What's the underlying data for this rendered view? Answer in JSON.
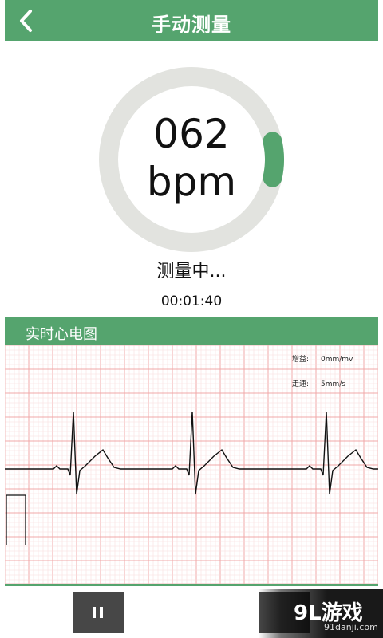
{
  "header": {
    "title": "手动测量",
    "back_icon": "chevron-left-icon"
  },
  "gauge": {
    "value": "062",
    "unit": "bpm",
    "progress_fraction": 0.07,
    "track_color": "#e2e3df",
    "fill_color": "#55a46e"
  },
  "measurement": {
    "status": "测量中...",
    "elapsed": "00:01:40"
  },
  "ecg": {
    "title": "实时心电图",
    "gain_label": "增益:",
    "gain_value": "0mm/mv",
    "speed_label": "走速:",
    "speed_value": "5mm/s",
    "grid_color": "#f2b9b9",
    "trace_color": "#111111"
  },
  "controls": {
    "pause_icon": "pause-icon",
    "right_icon": "unknown-action-icon"
  },
  "watermark": {
    "brand": "9L游戏",
    "url": "91danji.com"
  },
  "colors": {
    "accent": "#55a46e"
  }
}
